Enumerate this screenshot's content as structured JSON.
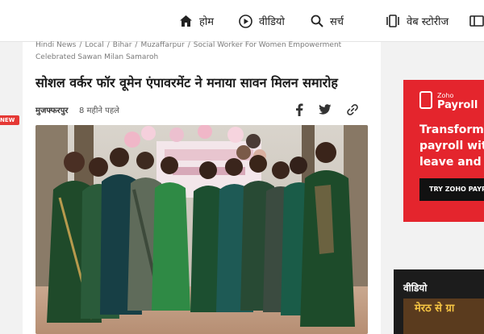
{
  "nav": {
    "items": [
      {
        "label": "होम",
        "icon": "home-icon"
      },
      {
        "label": "वीडियो",
        "icon": "play-circle-icon"
      },
      {
        "label": "सर्च",
        "icon": "search-icon"
      },
      {
        "label": "वेब स्टोरीज",
        "icon": "web-stories-icon"
      }
    ]
  },
  "breadcrumb": {
    "items": [
      "Hindi News",
      "Local",
      "Bihar",
      "Muzaffarpur",
      "Social Worker For Women Empowerment Celebrated Sawan Milan Samaroh"
    ]
  },
  "article": {
    "title": "सोशल वर्कर फॉर वूमेन एंपावरमेंट ने मनाया सावन मिलन समारोह",
    "city": "मुजफ्फरपुर",
    "time": "8 महीने पहले"
  },
  "badge": {
    "label": "NEW"
  },
  "ad": {
    "brand_small": "Zoho",
    "brand": "Payroll",
    "copy": "Transform payroll with leave and a",
    "cta": "TRY ZOHO PAYR"
  },
  "video": {
    "label": "वीडियो",
    "thumb_text": "मेरठ से ग्रा"
  },
  "colors": {
    "accent": "#e4252d",
    "saree_green": "#1f4a2a"
  }
}
